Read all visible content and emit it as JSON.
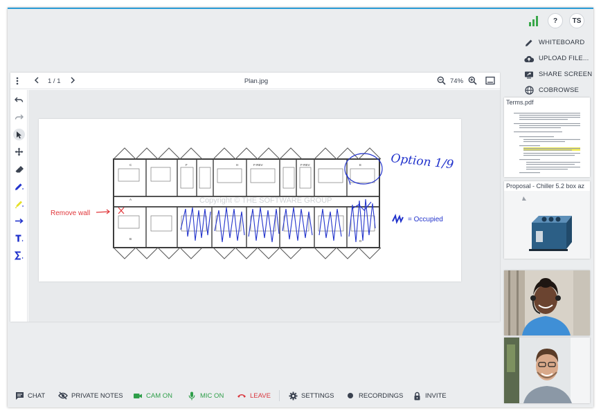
{
  "header": {
    "help_label": "?",
    "user_initials": "TS"
  },
  "actions": [
    {
      "label": "WHITEBOARD",
      "icon": "pencil-icon"
    },
    {
      "label": "UPLOAD FILE...",
      "icon": "cloud-upload-icon"
    },
    {
      "label": "SHARE SCREEN",
      "icon": "screen-share-icon"
    },
    {
      "label": "COBROWSE",
      "icon": "globe-icon"
    }
  ],
  "viewer": {
    "page_indicator": "1 / 1",
    "filename": "Plan.jpg",
    "zoom": "74%"
  },
  "plan": {
    "remove_wall_label": "Remove wall",
    "option_label": "Option 1/9",
    "legend_label": "= Occupied",
    "watermark": "Copyright © THE SOFTWARE GROUP",
    "room_labels": [
      "C",
      "F",
      "H",
      "F-REV",
      "F-REV",
      "E",
      "D",
      "B",
      "A"
    ]
  },
  "sidebar": {
    "documents": [
      {
        "title": "Terms.pdf"
      },
      {
        "title": "Proposal - Chiller 5.2 box az"
      }
    ]
  },
  "bottom_bar": {
    "chat": "CHAT",
    "private_notes": "PRIVATE NOTES",
    "cam": "CAM ON",
    "mic": "MIC ON",
    "leave": "LEAVE",
    "settings": "SETTINGS",
    "recordings": "RECORDINGS",
    "invite": "INVITE"
  },
  "colors": {
    "accent": "#2a9bd6",
    "green": "#2e9e49",
    "red": "#d9363e",
    "annotation_blue": "#2233cc",
    "annotation_red": "#e0363a"
  }
}
